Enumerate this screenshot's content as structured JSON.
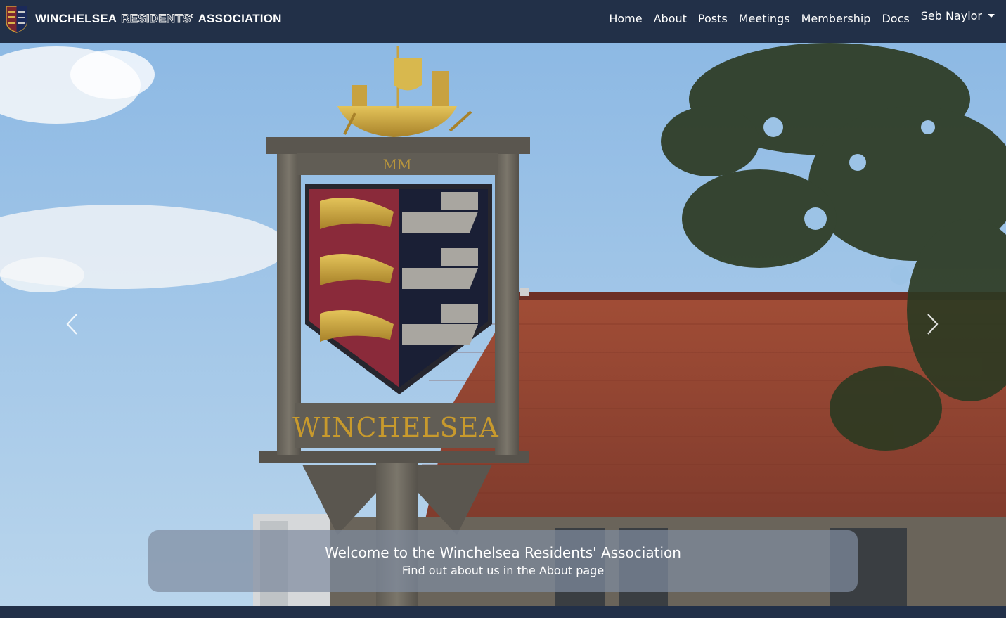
{
  "brand": {
    "part1": "WINCHELSEA",
    "part2": "RESIDENTS'",
    "part3": "ASSOCIATION",
    "logo": "winchelsea-shield-icon"
  },
  "nav": {
    "items": [
      {
        "label": "Home"
      },
      {
        "label": "About"
      },
      {
        "label": "Posts"
      },
      {
        "label": "Meetings"
      },
      {
        "label": "Membership"
      },
      {
        "label": "Docs"
      }
    ],
    "user": "Seb Naylor"
  },
  "hero": {
    "title": "Welcome to the Winchelsea Residents' Association",
    "subtitle": "Find out about us in the About page",
    "sign_top_text": "MM",
    "sign_name_text": "WINCHELSEA",
    "prev_icon": "chevron-left-icon",
    "next_icon": "chevron-right-icon"
  },
  "colors": {
    "navbar": "#223048",
    "sky": "#9cc3e6",
    "roof": "#9a4a35"
  }
}
